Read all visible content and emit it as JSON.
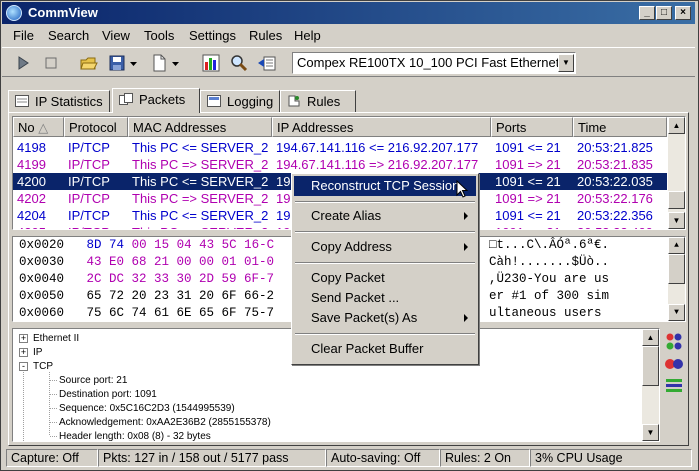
{
  "window": {
    "title": "CommView"
  },
  "menu": [
    "File",
    "Search",
    "View",
    "Tools",
    "Settings",
    "Rules",
    "Help"
  ],
  "toolbar": {
    "icons": [
      "play-icon",
      "stop-icon",
      "open-icon",
      "save-icon",
      "new-icon",
      "stats-icon",
      "search-icon",
      "export-icon"
    ],
    "adapter": "Compex RE100TX 10_100 PCI Fast Ethernet"
  },
  "tabs": [
    "IP Statistics",
    "Packets",
    "Logging",
    "Rules"
  ],
  "columns": [
    "No",
    "Protocol",
    "MAC Addresses",
    "IP Addresses",
    "Ports",
    "Time"
  ],
  "packets": [
    {
      "no": "4198",
      "proto": "IP/TCP",
      "mac": "This PC <= SERVER_2",
      "ip": "194.67.141.116 <= 216.92.207.177",
      "ports": "1091 <= 21",
      "time": "20:53:21.825",
      "color": "#0000cc"
    },
    {
      "no": "4199",
      "proto": "IP/TCP",
      "mac": "This PC => SERVER_2",
      "ip": "194.67.141.116 => 216.92.207.177",
      "ports": "1091 => 21",
      "time": "20:53:21.835",
      "color": "#b000b0"
    },
    {
      "no": "4200",
      "proto": "IP/TCP",
      "mac": "This PC <= SERVER_2",
      "ip": "19",
      "ports": "1091 <= 21",
      "time": "20:53:22.035",
      "color": "#ffffff"
    },
    {
      "no": "4202",
      "proto": "IP/TCP",
      "mac": "This PC => SERVER_2",
      "ip": "19",
      "ports": "1091 => 21",
      "time": "20:53:22.176",
      "color": "#b000b0"
    },
    {
      "no": "4204",
      "proto": "IP/TCP",
      "mac": "This PC <= SERVER_2",
      "ip": "19",
      "ports": "1091 <= 21",
      "time": "20:53:22.356",
      "color": "#0000cc"
    },
    {
      "no": "4205",
      "proto": "IP/TCP",
      "mac": "This PC => SERVER_2",
      "ip": "19",
      "ports": "1091 => 21",
      "time": "20:53:22.400",
      "color": "#b000b0"
    }
  ],
  "hex": [
    {
      "offset": "0x0020",
      "bytes1": "8D 74",
      "bytes2": "00 15 04 43 5C 16-C",
      "ascii": "□t...C\\.ÂÓª.6ª€."
    },
    {
      "offset": "0x0030",
      "bytes1": "",
      "bytes2": "43 E0 68 21 00 00 01 01-0",
      "ascii": "Càh!.......$Üò.."
    },
    {
      "offset": "0x0040",
      "bytes1": "",
      "bytes2": "2C DC 32 33 30 2D 59 6F-7",
      "ascii": ",Ü230-You are us"
    },
    {
      "offset": "0x0050",
      "bytes1": "",
      "bytes2": "65 72 20 23 31 20 6F 66-2",
      "ascii": "er #1 of 300 sim"
    },
    {
      "offset": "0x0060",
      "bytes1": "",
      "bytes2": "75 6C 74 61 6E 65 6F 75-7",
      "ascii": "ultaneous users"
    }
  ],
  "tree": {
    "nodes": [
      {
        "label": "Ethernet II",
        "expander": "+"
      },
      {
        "label": "IP",
        "expander": "+"
      },
      {
        "label": "TCP",
        "expander": "-"
      }
    ],
    "details": [
      "Source port: 21",
      "Destination port: 1091",
      "Sequence: 0x5C16C2D3 (1544995539)",
      "Acknowledgement: 0xAA2E36B2 (2855155378)",
      "Header length: 0x08 (8) - 32 bytes"
    ]
  },
  "status": [
    "Capture: Off",
    "Pkts: 127 in / 158 out / 5177 pass",
    "Auto-saving: Off",
    "Rules: 2 On",
    "3% CPU Usage"
  ],
  "context_menu": [
    {
      "label": "Reconstruct TCP Session",
      "submenu": false,
      "highlighted": true
    },
    {
      "label": "Create Alias",
      "submenu": true
    },
    {
      "label": "Copy Address",
      "submenu": true
    },
    {
      "label": "Copy Packet",
      "submenu": false
    },
    {
      "label": "Send Packet ...",
      "submenu": false
    },
    {
      "label": "Save Packet(s) As",
      "submenu": true
    },
    {
      "label": "Clear Packet Buffer",
      "submenu": false
    }
  ]
}
